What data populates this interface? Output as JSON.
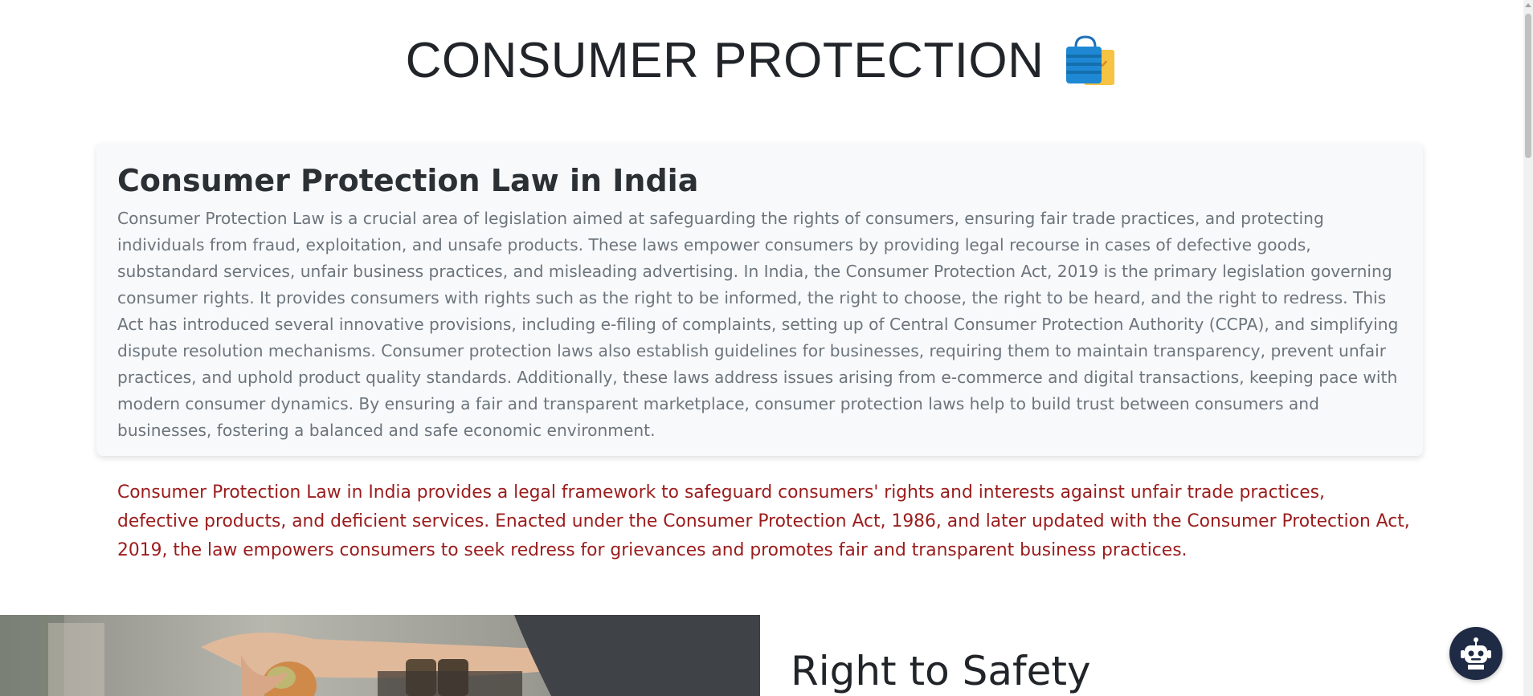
{
  "header": {
    "title": "CONSUMER PROTECTION",
    "icon": "shopping-bags-icon"
  },
  "intro": {
    "heading": "Consumer Protection Law in India",
    "text": "Consumer Protection Law is a crucial area of legislation aimed at safeguarding the rights of consumers, ensuring fair trade practices, and protecting individuals from fraud, exploitation, and unsafe products. These laws empower consumers by providing legal recourse in cases of defective goods, substandard services, unfair business practices, and misleading advertising. In India, the Consumer Protection Act, 2019 is the primary legislation governing consumer rights. It provides consumers with rights such as the right to be informed, the right to choose, the right to be heard, and the right to redress. This Act has introduced several innovative provisions, including e-filing of complaints, setting up of Central Consumer Protection Authority (CCPA), and simplifying dispute resolution mechanisms. Consumer protection laws also establish guidelines for businesses, requiring them to maintain transparency, prevent unfair practices, and uphold product quality standards. Additionally, these laws address issues arising from e-commerce and digital transactions, keeping pace with modern consumer dynamics. By ensuring a fair and transparent marketplace, consumer protection laws help to build trust between consumers and businesses, fostering a balanced and safe economic environment."
  },
  "highlight": {
    "text": "Consumer Protection Law in India provides a legal framework to safeguard consumers' rights and interests against unfair trade practices, defective products, and deficient services. Enacted under the Consumer Protection Act, 1986, and later updated with the Consumer Protection Act, 2019, the law empowers consumers to seek redress for grievances and promotes fair and transparent business practices.",
    "color": "#9b1c1c"
  },
  "section": {
    "heading": "Right to Safety",
    "image_icon": "market-photo"
  },
  "chatbot": {
    "icon": "robot-icon",
    "color": "#1f2a44"
  }
}
